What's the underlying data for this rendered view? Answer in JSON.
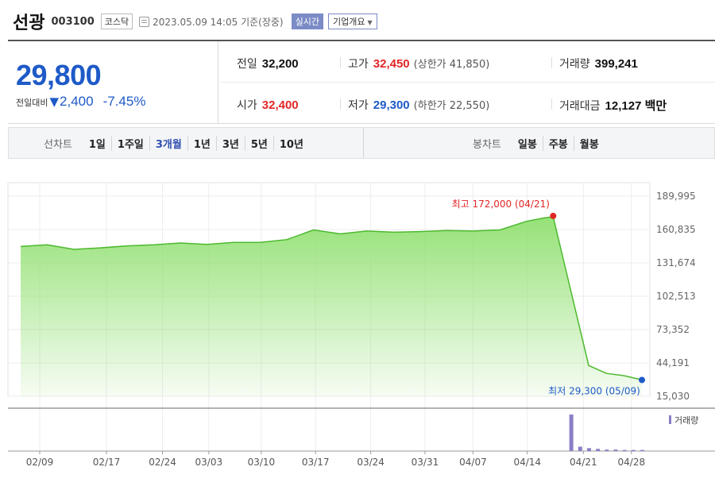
{
  "header": {
    "stock_name": "선광",
    "stock_code": "003100",
    "market": "코스닥",
    "timestamp": "2023.05.09 14:05",
    "basis": "기준(장중)",
    "realtime_label": "실시간",
    "company_info_label": "기업개요"
  },
  "quote": {
    "price": "29,800",
    "change_label": "전일대비",
    "change_icon": "down-triangle",
    "change_amount": "2,400",
    "change_percent": "-7.45%",
    "prev_close_label": "전일",
    "prev_close": "32,200",
    "high_label": "고가",
    "high": "32,450",
    "upper_limit_label": "(상한가 41,850)",
    "volume_label": "거래량",
    "volume": "399,241",
    "open_label": "시가",
    "open": "32,400",
    "low_label": "저가",
    "low": "29,300",
    "lower_limit_label": "(하한가 22,550)",
    "amount_label": "거래대금",
    "amount": "12,127 백만"
  },
  "periods": {
    "line_label": "선차트",
    "line_items": [
      "1일",
      "1주일",
      "3개월",
      "1년",
      "3년",
      "5년",
      "10년"
    ],
    "active": "3개월",
    "candle_label": "봉차트",
    "candle_items": [
      "일봉",
      "주봉",
      "월봉"
    ]
  },
  "colors": {
    "price_blue": "#1e5ac8",
    "up_red": "#e22626",
    "area_fill": "#90e070",
    "line_green": "#4cb92e",
    "volume_purple": "#8a7fc4"
  },
  "chart_data": {
    "type": "area",
    "ylim": [
      15030,
      189995
    ],
    "y_ticks": [
      "189,995",
      "160,835",
      "131,674",
      "102,513",
      "73,352",
      "44,191",
      "15,030"
    ],
    "x_tick_labels": [
      "02/09",
      "02/17",
      "02/24",
      "03/03",
      "03/10",
      "03/17",
      "03/24",
      "03/31",
      "04/07",
      "04/14",
      "04/21",
      "04/28"
    ],
    "x": [
      0,
      3,
      6,
      9,
      12,
      15,
      18,
      21,
      24,
      27,
      30,
      33,
      36,
      39,
      42,
      45,
      48,
      51,
      54,
      57,
      59,
      60,
      62,
      64,
      66,
      68,
      70
    ],
    "values": [
      146000,
      147500,
      143500,
      144800,
      146500,
      147500,
      149000,
      147800,
      149500,
      149500,
      152000,
      160500,
      157000,
      159500,
      158500,
      159000,
      160000,
      159500,
      160500,
      168000,
      171000,
      172000,
      107000,
      42000,
      35000,
      33000,
      29300
    ],
    "annotations": {
      "high": "최고 172,000 (04/21)",
      "low": "최저 29,300 (05/09)"
    },
    "volume_label": "거래량",
    "volume_bars": [
      {
        "x": 62,
        "value": 100
      },
      {
        "x": 63,
        "value": 12
      },
      {
        "x": 64,
        "value": 8
      },
      {
        "x": 65,
        "value": 6
      },
      {
        "x": 66,
        "value": 4
      },
      {
        "x": 67,
        "value": 4
      },
      {
        "x": 68,
        "value": 3
      },
      {
        "x": 69,
        "value": 3
      },
      {
        "x": 70,
        "value": 3
      }
    ]
  }
}
